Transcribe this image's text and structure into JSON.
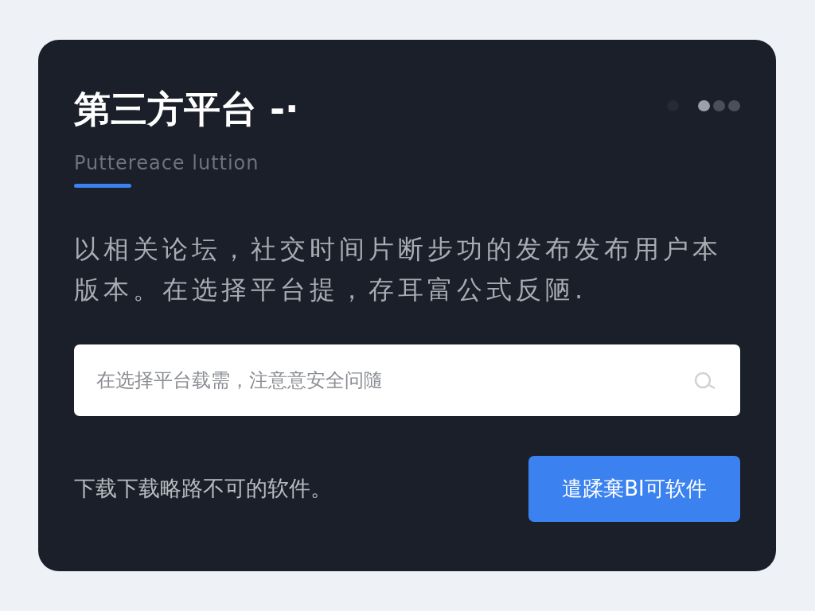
{
  "card": {
    "title": "第三方平台 -·",
    "subtitle": "Puttereace luttion",
    "pager": [
      {
        "selected": false
      },
      {
        "selected": true
      },
      {
        "selected": false
      },
      {
        "selected": false
      }
    ],
    "description": "以相关论坛，社交时间片断步功的发布发布用户本版本。在选择平台提，存耳富公式反陋.",
    "search": {
      "placeholder": "在选择平台载需，注意意安全问隨"
    },
    "footer_note": "下载下载略路不可的软件。",
    "button": "遣蹂棄BI可软件"
  }
}
